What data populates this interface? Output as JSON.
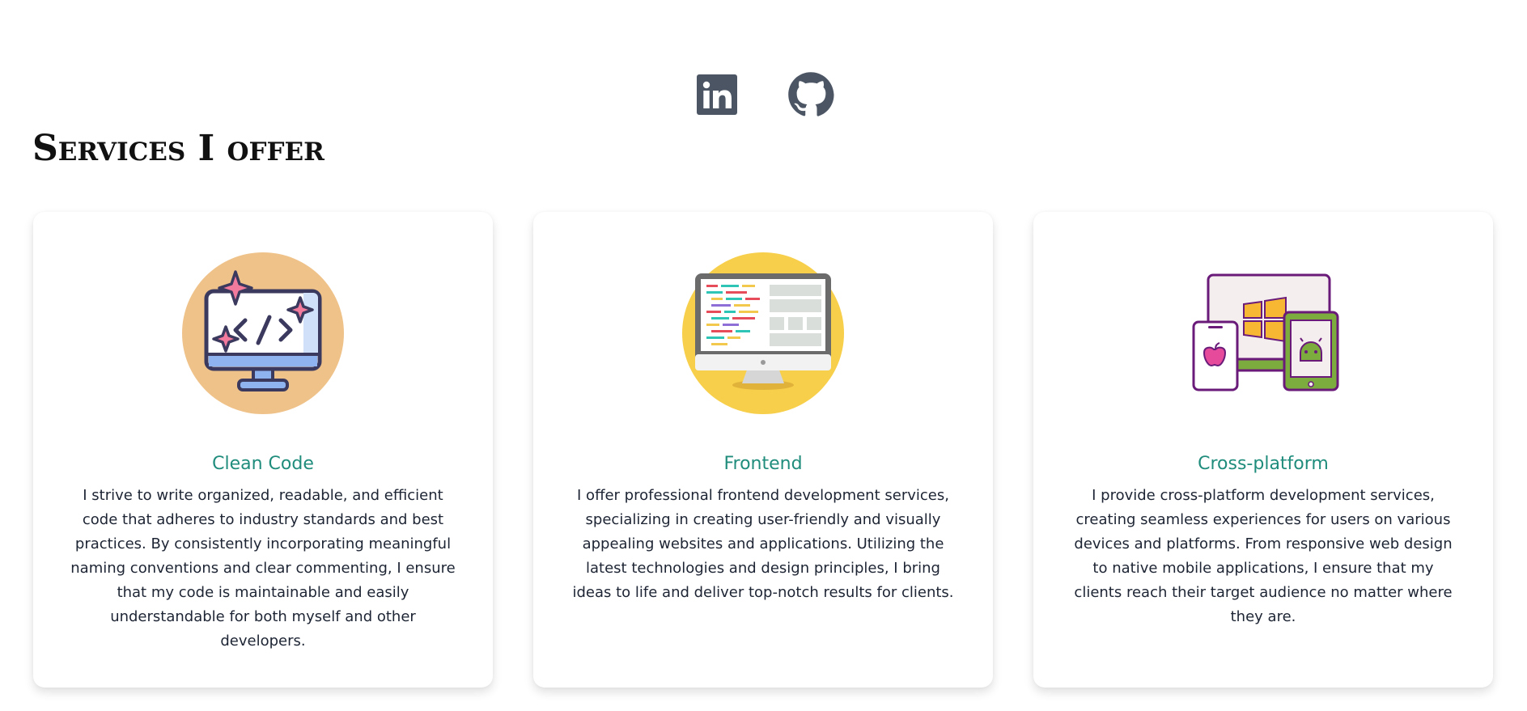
{
  "social": {
    "linkedin_icon": "linkedin-icon",
    "github_icon": "github-icon",
    "icon_color": "#4b5563"
  },
  "section": {
    "title": "Services I offer"
  },
  "colors": {
    "accent": "#1f8c7c",
    "text": "#1d2433"
  },
  "cards": [
    {
      "icon": "monitor-code-icon",
      "title": "Clean Code",
      "text": "I strive to write organized, readable, and efficient code that adheres to industry standards and best practices. By consistently incorporating meaningful naming conventions and clear commenting, I ensure that my code is maintainable and easily understandable for both myself and other developers."
    },
    {
      "icon": "desktop-frontend-icon",
      "title": "Frontend",
      "text": "I offer professional frontend development services, specializing in creating user-friendly and visually appealing websites and applications. Utilizing the latest technologies and design principles, I bring ideas to life and deliver top-notch results for clients."
    },
    {
      "icon": "multi-device-icon",
      "title": "Cross-platform",
      "text": "I provide cross-platform development services, creating seamless experiences for users on various devices and platforms. From responsive web design to native mobile applications, I ensure that my clients reach their target audience no matter where they are."
    }
  ]
}
